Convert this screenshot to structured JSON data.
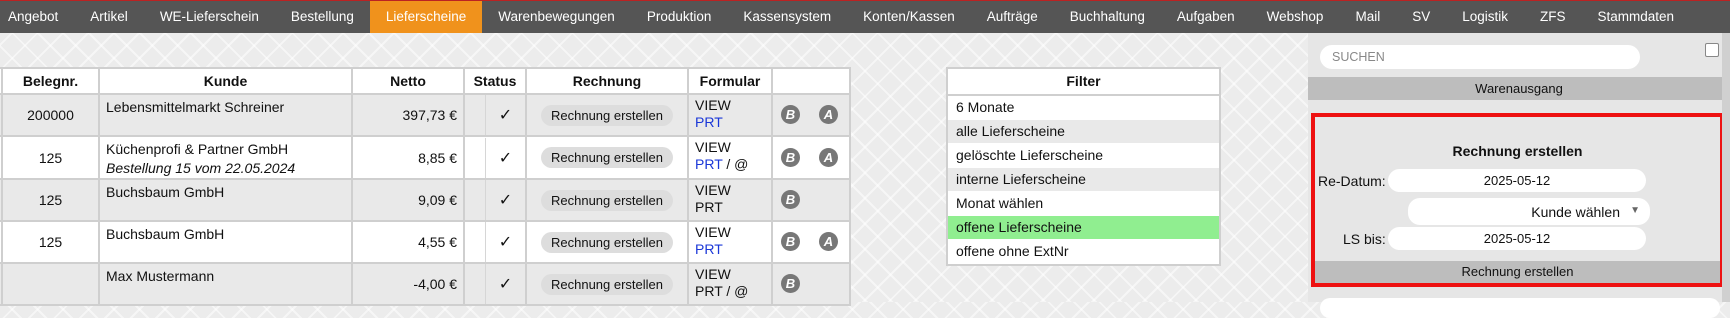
{
  "nav": {
    "items": [
      "Angebot",
      "Artikel",
      "WE-Lieferschein",
      "Bestellung",
      "Lieferscheine",
      "Warenbewegungen",
      "Produktion",
      "Kassensystem",
      "Konten/Kassen",
      "Aufträge",
      "Buchhaltung",
      "Aufgaben",
      "Webshop",
      "Mail",
      "SV",
      "Logistik",
      "ZFS",
      "Stammdaten"
    ],
    "active": "Lieferscheine",
    "active_color": "#f0921c",
    "bar_color": "#555555"
  },
  "table": {
    "headers": {
      "belegnr": "Belegnr.",
      "kunde": "Kunde",
      "netto": "Netto",
      "status": "Status",
      "rechnung": "Rechnung",
      "formular": "Formular"
    },
    "rows": [
      {
        "prefix": "5",
        "belegnr": "200000",
        "kunde": "Lebensmittelmarkt Schreiner",
        "kunde_sub": "",
        "netto": "397,73 €",
        "status": "✓",
        "rechnung": "Rechnung erstellen",
        "view": "VIEW",
        "prt": "PRT",
        "prt_blue": true,
        "extra": "",
        "icon_b": "B",
        "icon_a": "A"
      },
      {
        "prefix": "5",
        "belegnr": "125",
        "kunde": "Küchenprofi & Partner GmbH",
        "kunde_sub": "Bestellung 15 vom 22.05.2024",
        "netto": "8,85 €",
        "status": "✓",
        "rechnung": "Rechnung erstellen",
        "view": "VIEW",
        "prt": "PRT",
        "prt_blue": true,
        "extra": " / @",
        "icon_b": "B",
        "icon_a": "A"
      },
      {
        "prefix": "5",
        "belegnr": "125",
        "kunde": "Buchsbaum GmbH",
        "kunde_sub": "",
        "netto": "9,09 €",
        "status": "✓",
        "rechnung": "Rechnung erstellen",
        "view": "VIEW",
        "prt": "PRT",
        "prt_blue": false,
        "extra": "",
        "icon_b": "B",
        "icon_a": ""
      },
      {
        "prefix": "5",
        "belegnr": "125",
        "kunde": "Buchsbaum GmbH",
        "kunde_sub": "",
        "netto": "4,55 €",
        "status": "✓",
        "rechnung": "Rechnung erstellen",
        "view": "VIEW",
        "prt": "PRT",
        "prt_blue": true,
        "extra": "",
        "icon_b": "B",
        "icon_a": "A"
      },
      {
        "prefix": "5",
        "belegnr": "",
        "kunde": "Max Mustermann",
        "kunde_sub": "",
        "netto": "-4,00 €",
        "status": "✓",
        "rechnung": "Rechnung erstellen",
        "view": "VIEW",
        "prt": "PRT",
        "prt_blue": false,
        "extra": " / @",
        "icon_b": "B",
        "icon_a": ""
      }
    ]
  },
  "filter": {
    "title": "Filter",
    "items": [
      "6 Monate",
      "alle Lieferscheine",
      "gelöschte Lieferscheine",
      "interne Lieferscheine",
      "Monat wählen",
      "offene Lieferscheine",
      "offene ohne ExtNr"
    ],
    "active": "offene Lieferscheine",
    "active_color": "#90ee90"
  },
  "panel": {
    "search_placeholder": "SUCHEN",
    "section_label": "Warenausgang",
    "invoice": {
      "title": "Rechnung erstellen",
      "re_datum_label": "Re-Datum:",
      "re_datum_value": "2025-05-12",
      "customer_select": "Kunde wählen",
      "ls_bis_label": "LS bis:",
      "ls_bis_value": "2025-05-12",
      "button_label": "Rechnung erstellen",
      "highlight_color": "#e11111"
    }
  }
}
